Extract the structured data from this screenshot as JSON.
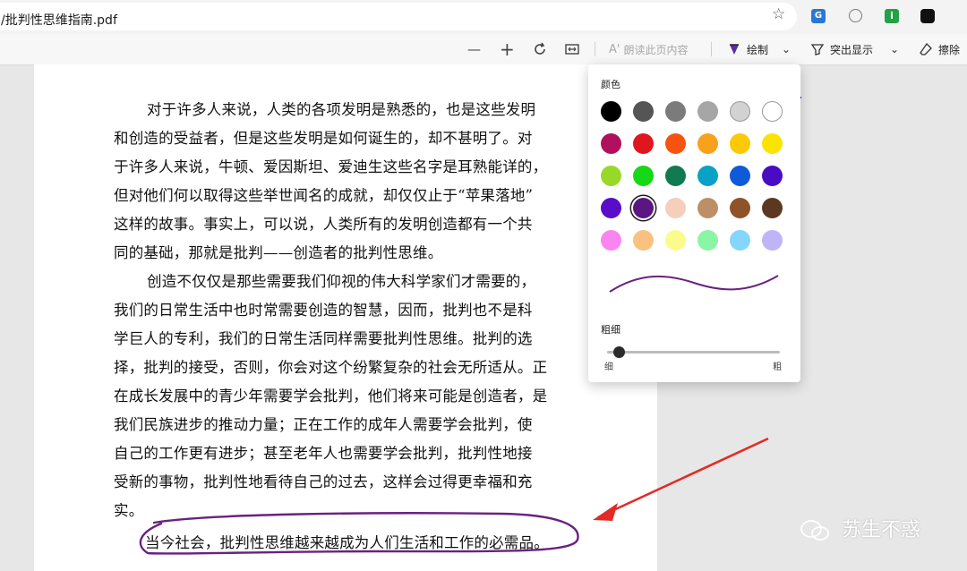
{
  "address": {
    "url": "/批判性思维指南.pdf",
    "star_icon": "star-icon"
  },
  "toolbar": {
    "zoom_out": "—",
    "zoom_in": "+",
    "read_aloud": "朗读此页内容",
    "draw": "绘制",
    "highlight": "突出显示",
    "erase": "擦除"
  },
  "document": {
    "lines": [
      "对于许多人来说，人类的各项发明是熟悉的，也是这些发明",
      "和创造的受益者，但是这些发明是如何诞生的，却不甚明了。对",
      "于许多人来说，牛顿、爱因斯坦、爱迪生这些名字是耳熟能详的，",
      "但对他们何以取得这些举世闻名的成就，却仅仅止于“苹果落地”",
      "这样的故事。事实上，可以说，人类所有的发明创造都有一个共",
      "同的基础，那就是批判——创造者的批判性思维。",
      "创造不仅仅是那些需要我们仰视的伟大科学家们才需要的，",
      "我们的日常生活中也时常需要创造的智慧，因而，批判也不是科",
      "学巨人的专利，我们的日常生活同样需要批判性思维。批判的选",
      "择，批判的接受，否则，你会对这个纷繁复杂的社会无所适从。正",
      "在成长发展中的青少年需要学会批判，他们将来可能是创造者，是",
      "我们民族进步的推动力量；正在工作的成年人需要学会批判，使",
      "自己的工作更有进步；甚至老年人也需要学会批判，批判性地接",
      "受新的事物，批判性地看待自己的过去，这样会过得更幸福和充",
      "实。",
      "当今社会，批判性思维越来越成为人们生活和工作的必需品。"
    ]
  },
  "draw_panel": {
    "color_label": "颜色",
    "thickness_label": "粗细",
    "thin_label": "细",
    "thick_label": "粗",
    "selected_color": "#5b1682",
    "thickness_value": 0.05,
    "colors": [
      "#000000",
      "#555555",
      "#7b7b7b",
      "#a6a6a6",
      "#d2d2d2",
      "#ffffff",
      "#b0105e",
      "#e0161e",
      "#f7530f",
      "#f8a11a",
      "#fbc905",
      "#fbe300",
      "#98d928",
      "#17d717",
      "#117a50",
      "#0aa1c6",
      "#0e5ad8",
      "#4a0cc2",
      "#5a0dc9",
      "#5b1682",
      "#f4cfba",
      "#be8f66",
      "#8e5328",
      "#5d3821",
      "#fa85f0",
      "#fbc180",
      "#fbfb8b",
      "#8bf5a6",
      "#84d6fc",
      "#c0b4f8"
    ]
  },
  "annotation": {
    "ink_color": "#6a2180",
    "arrow_color": "#e22b25"
  },
  "watermark": {
    "text": "苏生不惑"
  }
}
